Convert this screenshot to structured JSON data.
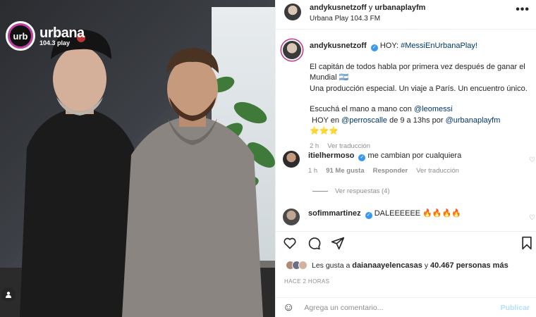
{
  "photo": {
    "logo_mark": "urb",
    "logo_name": "urbana",
    "logo_sub": "104.3 play"
  },
  "header": {
    "user1": "andykusnetzoff",
    "connector": " y ",
    "user2": "urbanaplayfm",
    "subtitle": "Urbana Play 104.3 FM",
    "more": "•••"
  },
  "caption": {
    "username": "andykusnetzoff",
    "intro": "HOY: ",
    "hashtag": "#MessiEnUrbanaPlay!",
    "line1": "El capitán de todos habla por primera vez después de ganar el Mundial 🇦🇷",
    "line2": "Una producción especial. Un viaje a París. Un encuentro único.",
    "line3_pre": "Escuchá el mano a mano con ",
    "mention1": "@leomessi",
    "line3_mid": " HOY en ",
    "mention2": "@perroscalle",
    "line3_post": " de 9 a 13hs por ",
    "mention3": "@urbanaplayfm",
    "stars": " ⭐⭐⭐",
    "time": "2 h",
    "translate": "Ver traducción"
  },
  "comments": [
    {
      "username": "itielhermoso",
      "text": "me cambian por cualquiera",
      "time": "1 h",
      "likes": "91 Me gusta",
      "reply": "Responder",
      "translate": "Ver traducción",
      "view_replies": "Ver respuestas (4)"
    },
    {
      "username": "sofimmartinez",
      "text": "DALEEEEEE 🔥🔥🔥🔥"
    }
  ],
  "likes": {
    "prefix": "Les gusta a ",
    "user": "daianaayelencasas",
    "mid": " y ",
    "count": "40.467 personas más"
  },
  "date": "HACE 2 HORAS",
  "composer": {
    "placeholder": "Agrega un comentario...",
    "publish": "Publicar"
  },
  "colors": {
    "link": "#00376b",
    "verified": "#3897f0",
    "muted": "#8e8e8e",
    "publish_disabled": "#b2dffc"
  }
}
